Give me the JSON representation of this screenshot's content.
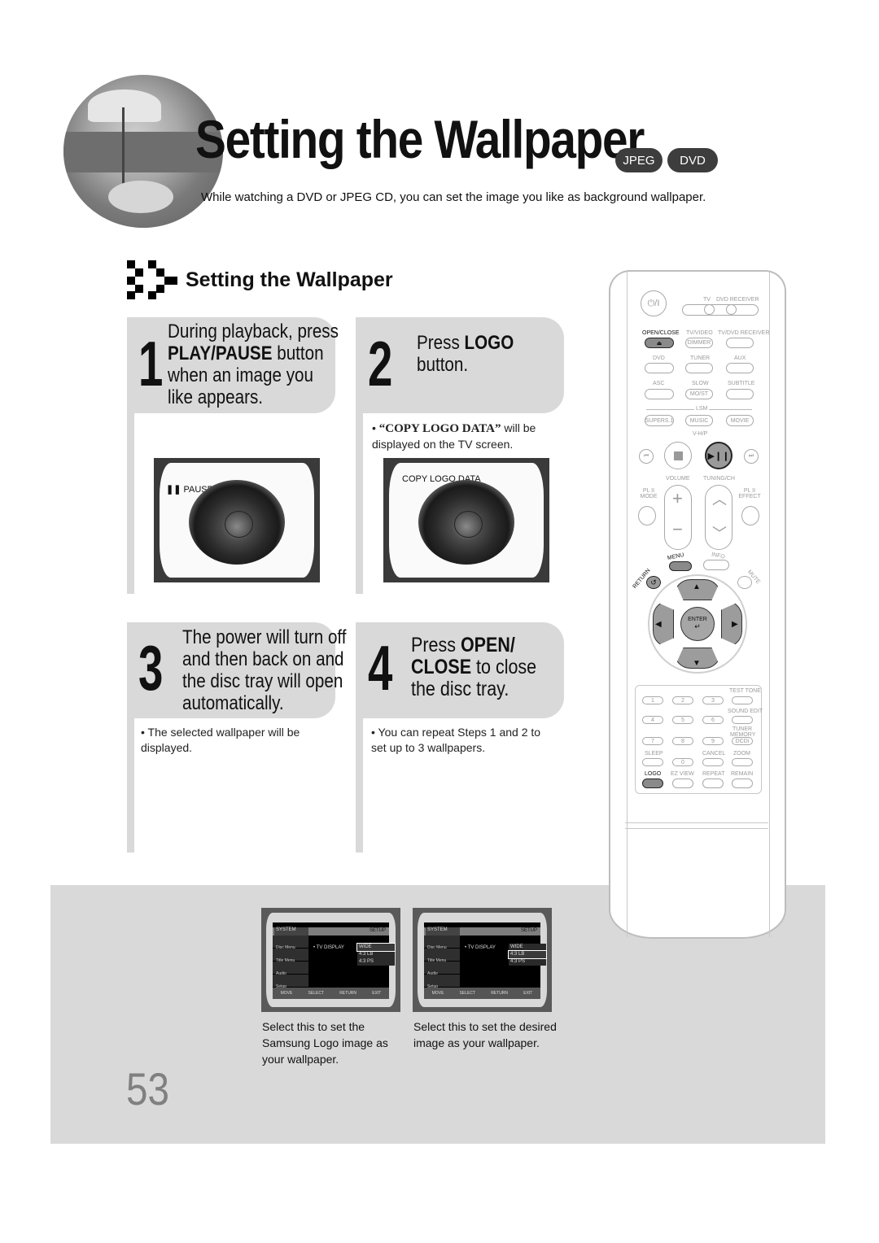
{
  "header": {
    "title": "Setting the Wallpaper",
    "badges": [
      "JPEG",
      "DVD"
    ],
    "intro": "While watching a DVD or JPEG CD, you can set the image you like as background wallpaper."
  },
  "section": {
    "title": "Setting the Wallpaper"
  },
  "steps": [
    {
      "number": "1",
      "lines": [
        {
          "pre": "During playback, press",
          "bold": "",
          "post": ""
        },
        {
          "pre": "",
          "bold": "PLAY/PAUSE",
          "post": " button"
        },
        {
          "pre": "when an image you",
          "bold": "",
          "post": ""
        },
        {
          "pre": "like appears.",
          "bold": "",
          "post": ""
        }
      ],
      "note": "",
      "screen_label": "PAUSE",
      "screen_icon": "pause-icon"
    },
    {
      "number": "2",
      "lines": [
        {
          "pre": "Press ",
          "bold": "LOGO",
          "post": ""
        },
        {
          "pre": "button.",
          "bold": "",
          "post": ""
        }
      ],
      "note_quote": "“COPY LOGO DATA”",
      "note_rest": " will be displayed on the TV screen.",
      "screen_label": "COPY LOGO DATA"
    },
    {
      "number": "3",
      "lines": [
        {
          "pre": "The power will turn off",
          "bold": "",
          "post": ""
        },
        {
          "pre": "and then back on and",
          "bold": "",
          "post": ""
        },
        {
          "pre": "the disc tray will open",
          "bold": "",
          "post": ""
        },
        {
          "pre": "automatically.",
          "bold": "",
          "post": ""
        }
      ],
      "note": "The selected wallpaper will be displayed."
    },
    {
      "number": "4",
      "lines": [
        {
          "pre": "Press ",
          "bold": "OPEN/",
          "post": ""
        },
        {
          "pre": "",
          "bold": "CLOSE",
          "post": " to close"
        },
        {
          "pre": "the disc tray.",
          "bold": "",
          "post": ""
        }
      ],
      "note": "You can repeat Steps 1 and 2 to set up to 3 wallpapers."
    }
  ],
  "menu_screens": [
    {
      "header_left": "SYSTEM",
      "header_right": "SETUP",
      "side": [
        "Disc Menu",
        "Title Menu",
        "Audio",
        "Setup"
      ],
      "option_label": "• TV DISPLAY",
      "options": [
        "WIDE",
        "4:3 LB",
        "4:3 PS"
      ],
      "selected": 0,
      "footer": [
        "MOVE",
        "SELECT",
        "RETURN",
        "EXIT"
      ],
      "caption": "Select this to set the Samsung Logo image as your wallpaper."
    },
    {
      "header_left": "SYSTEM",
      "header_right": "SETUP",
      "side": [
        "Disc Menu",
        "Title Menu",
        "Audio",
        "Setup"
      ],
      "option_label": "• TV DISPLAY",
      "options": [
        "WIDE",
        "4:3 LB",
        "4:3 PS"
      ],
      "selected": 1,
      "footer": [
        "MOVE",
        "SELECT",
        "RETURN",
        "EXIT"
      ],
      "caption": "Select this to set the desired image as your wallpaper."
    }
  ],
  "page_number": "53",
  "remote": {
    "power": "⏻/I",
    "tv": "TV",
    "dvd_receiver": "DVD RECEIVER",
    "open_close": "OPEN/CLOSE",
    "tv_video": "TV/VIDEO",
    "tv_dvd_receiver": "TV/DVD RECEIVER",
    "dimmer": "DIMMER",
    "dvd": "DVD",
    "tuner": "TUNER",
    "aux": "AUX",
    "asc": "ASC",
    "slow": "SLOW",
    "mo_st": "MO/ST",
    "subtitle": "SUBTITLE",
    "lsm": "LSM",
    "supers": "SUPERS.1",
    "music": "MUSIC",
    "movie": "MOVIE",
    "vhp": "V-H/P",
    "volume": "VOLUME",
    "tuning_ch": "TUNING/CH",
    "pl2_mode": "PL II MODE",
    "pl2_effect": "PL II EFFECT",
    "menu": "MENU",
    "info": "INFO",
    "return": "RETURN",
    "mute": "MUTE",
    "enter": "ENTER",
    "numbers": [
      "1",
      "2",
      "3",
      "4",
      "5",
      "6",
      "7",
      "8",
      "9",
      "0"
    ],
    "test_tone": "TEST TONE",
    "sound_edit": "SOUND EDIT",
    "tuner_memory": "TUNER MEMORY",
    "dcdi": "DCDi",
    "sleep": "SLEEP",
    "cancel": "CANCEL",
    "zoom": "ZOOM",
    "logo": "LOGO",
    "ez_view": "EZ VIEW",
    "repeat": "REPEAT",
    "remain": "REMAIN"
  }
}
